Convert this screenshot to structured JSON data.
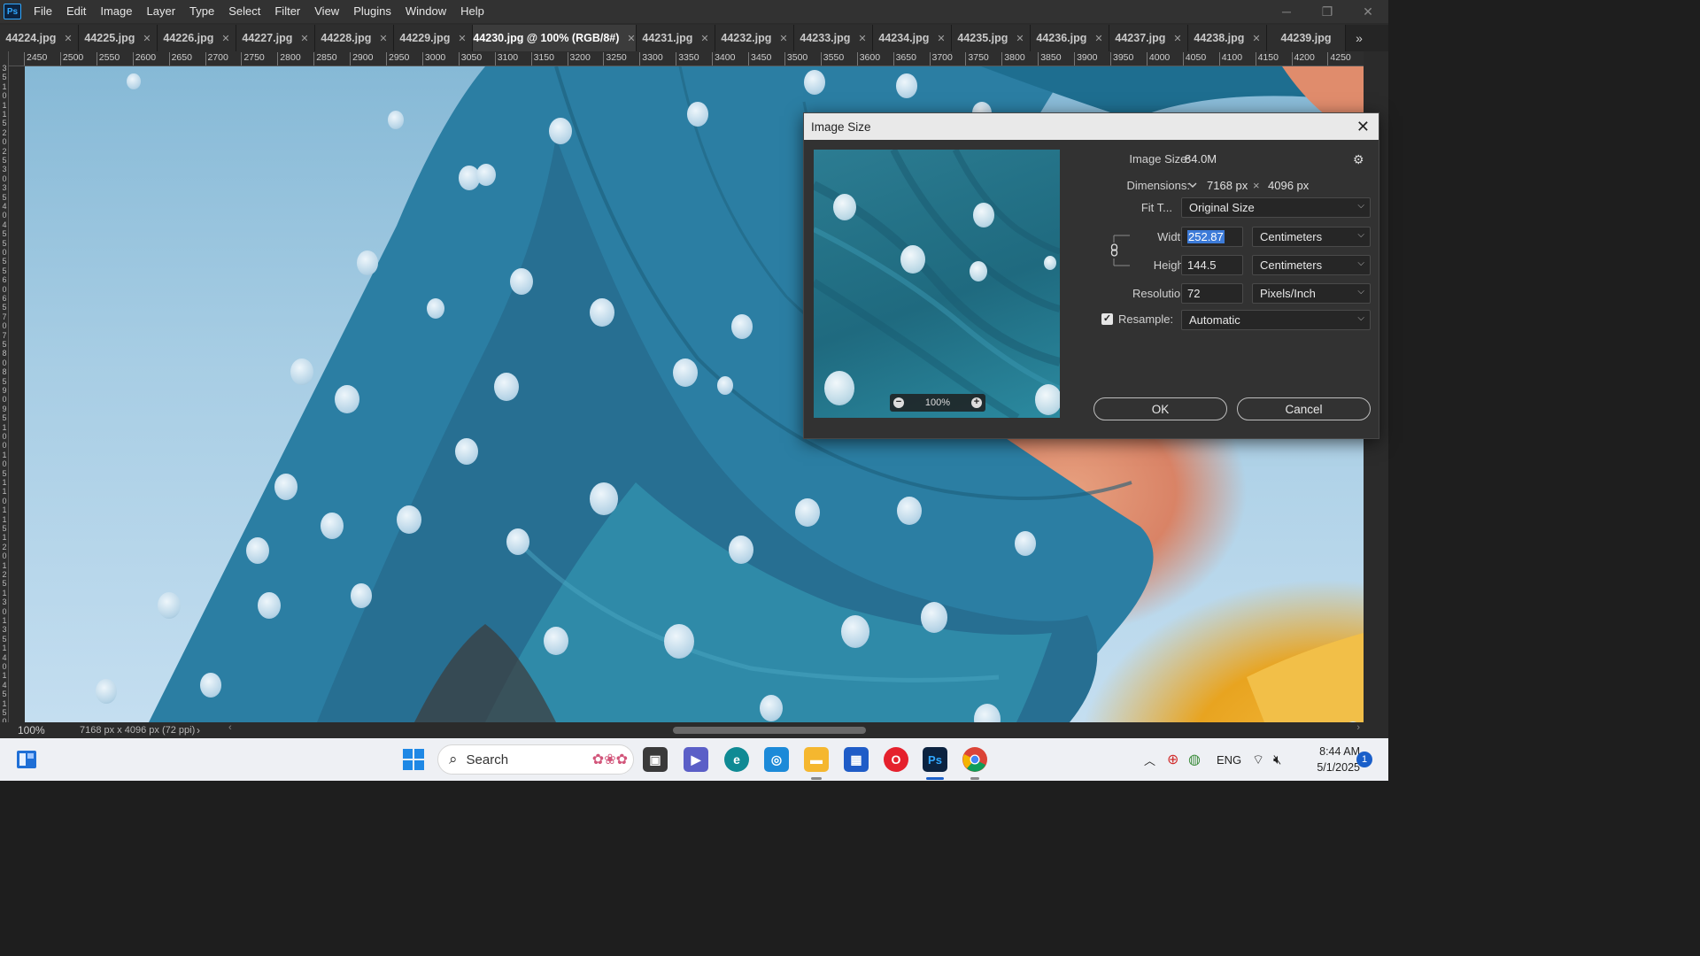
{
  "app": {
    "logo": "Ps"
  },
  "menu": [
    "File",
    "Edit",
    "Image",
    "Layer",
    "Type",
    "Select",
    "Filter",
    "View",
    "Plugins",
    "Window",
    "Help"
  ],
  "window_controls": {
    "minimize": "─",
    "restore": "❐",
    "close": "✕"
  },
  "tabs": [
    "44224.jpg",
    "44225.jpg",
    "44226.jpg",
    "44227.jpg",
    "44228.jpg",
    "44229.jpg",
    "44230.jpg @ 100% (RGB/8#)",
    "44231.jpg",
    "44232.jpg",
    "44233.jpg",
    "44234.jpg",
    "44235.jpg",
    "44236.jpg",
    "44237.jpg",
    "44238.jpg",
    "44239.jpg"
  ],
  "active_tab_index": 6,
  "tab_overflow": "»",
  "ruler_top": [
    "2450",
    "2500",
    "2550",
    "2600",
    "2650",
    "2700",
    "2750",
    "2800",
    "2850",
    "2900",
    "2950",
    "3000",
    "3050",
    "3100",
    "3150",
    "3200",
    "3250",
    "3300",
    "3350",
    "3400",
    "3450",
    "3500",
    "3550",
    "3600",
    "3650",
    "3700",
    "3750",
    "3800",
    "3850",
    "3900",
    "3950",
    "4000",
    "4050",
    "4100",
    "4150",
    "4200",
    "4250"
  ],
  "ruler_left": [
    "3",
    "5",
    "1",
    "0",
    "1",
    "1",
    "5",
    "2",
    "0",
    "2",
    "5",
    "3",
    "0",
    "3",
    "5",
    "4",
    "0",
    "4",
    "5",
    "5",
    "0",
    "5",
    "5",
    "6",
    "0",
    "6",
    "5",
    "7",
    "0",
    "7",
    "5",
    "8",
    "0",
    "8",
    "5",
    "9",
    "0",
    "9",
    "5",
    "1",
    "0",
    "0",
    "1",
    "0",
    "5",
    "1",
    "1",
    "0",
    "1",
    "1",
    "5",
    "1",
    "2",
    "0",
    "1",
    "2",
    "5",
    "1",
    "3",
    "0",
    "1",
    "3",
    "5",
    "1",
    "4",
    "0",
    "1",
    "4",
    "5",
    "1",
    "5",
    "0"
  ],
  "status": {
    "zoom": "100%",
    "doc_info": "7168 px x 4096 px (72 ppi)",
    "arrow": "›",
    "scroll_left": "‹",
    "scroll_right": "›"
  },
  "dialog": {
    "title": "Image Size",
    "close": "✕",
    "preview_zoom": "100%",
    "image_size_label": "Image Size:",
    "image_size_value": "84.0M",
    "dimensions_label": "Dimensions:",
    "dim_width": "7168 px",
    "dim_x": "×",
    "dim_height": "4096 px",
    "fit_to_label": "Fit T...",
    "fit_to_value": "Original Size",
    "width_label": "Width:",
    "width_value": "252.87",
    "width_unit": "Centimeters",
    "height_label": "Height:",
    "height_value": "144.5",
    "height_unit": "Centimeters",
    "resolution_label": "Resolution:",
    "resolution_value": "72",
    "resolution_unit": "Pixels/Inch",
    "resample_label": "Resample:",
    "resample_checked": true,
    "resample_value": "Automatic",
    "ok_label": "OK",
    "cancel_label": "Cancel"
  },
  "taskbar": {
    "search_placeholder": "Search",
    "lang": "ENG",
    "time": "8:44 AM",
    "date": "5/1/2025",
    "notifications": "1",
    "photoshop_label": "Ps"
  },
  "colors": {
    "accent": "#3d7bd8",
    "ps_blue": "#31a8ff",
    "dialog_bg": "#323232"
  }
}
